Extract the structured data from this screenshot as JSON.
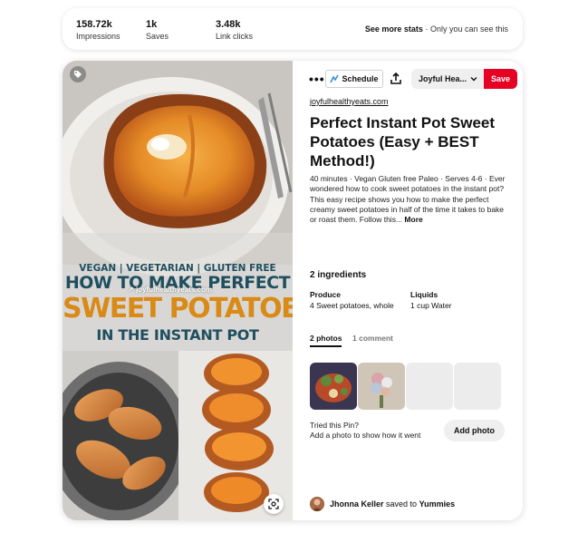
{
  "stats": [
    {
      "value": "158.72k",
      "label": "Impressions"
    },
    {
      "value": "1k",
      "label": "Saves"
    },
    {
      "value": "3.48k",
      "label": "Link clicks"
    }
  ],
  "see_more": {
    "label": "See more stats",
    "note": "Only you can see this"
  },
  "pin": {
    "image": {
      "line1": "VEGAN | VEGETARIAN | GLUTEN FREE",
      "line2": "HOW TO MAKE PERFECT",
      "line3": "SWEET POTATOES",
      "line4": "IN THE INSTANT POT",
      "watermark": "joyfulhealthyeats.com"
    },
    "toolbar": {
      "more": "•••",
      "schedule": "Schedule",
      "board": "Joyful Hea...",
      "save": "Save"
    },
    "source": "joyfulhealthyeats.com",
    "title": "Perfect Instant Pot Sweet Potatoes (Easy + BEST Method!)",
    "description": "40 minutes · Vegan Gluten free Paleo · Serves 4-6 · Ever wondered how to cook sweet potatoes in the instant pot? This easy recipe shows you how to make the perfect creamy sweet potatoes in half of the time it takes to bake or roast them. Follow this...",
    "description_more": "More",
    "ingredients": {
      "title": "2 ingredients",
      "produce_heading": "Produce",
      "produce_item": "4 Sweet potatoes, whole",
      "liquids_heading": "Liquids",
      "liquids_item": "1 cup Water"
    },
    "tabs": [
      {
        "label": "2 photos",
        "active": true
      },
      {
        "label": "1 comment",
        "active": false
      }
    ],
    "tried": {
      "line1": "Tried this Pin?",
      "line2": "Add a photo to show how it went",
      "button": "Add photo"
    },
    "saved_by": {
      "user": "Jhonna Keller",
      "action": "saved to",
      "board": "Yummies"
    }
  },
  "colors": {
    "save": "#e60023",
    "schedule_icon": "#3b8fd4"
  }
}
